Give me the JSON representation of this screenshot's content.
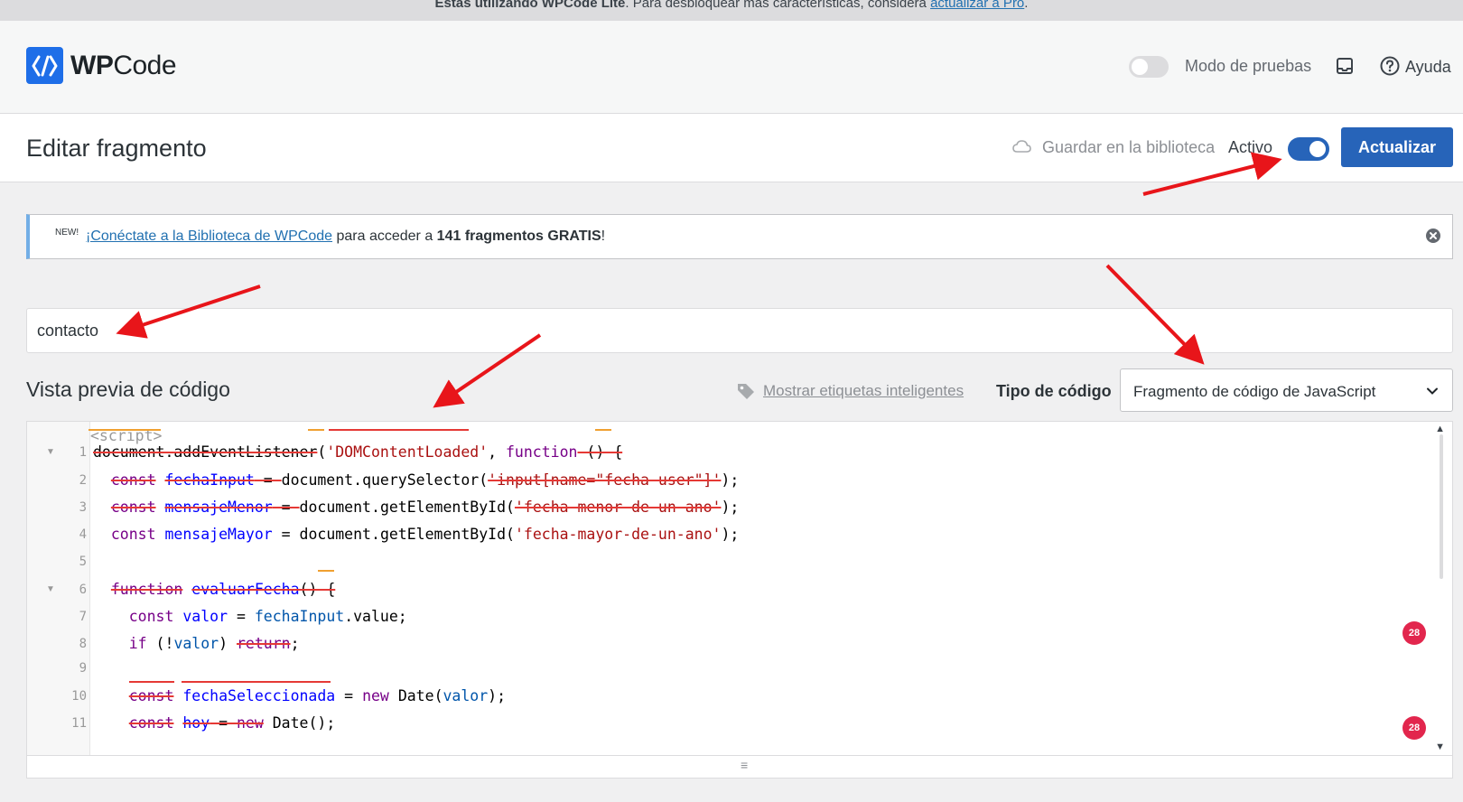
{
  "top_notice": {
    "prefix": "Estás utilizando WPCode Lite",
    "middle": ". Para desbloquear más características, considera ",
    "link": "actualizar a Pro",
    "suffix": "."
  },
  "header": {
    "logo_wp": "WP",
    "logo_code": "Code",
    "test_mode_label": "Modo de pruebas",
    "help_label": "Ayuda"
  },
  "titlebar": {
    "title": "Editar fragmento",
    "save_library": "Guardar en la biblioteca",
    "active_label": "Activo",
    "update_button": "Actualizar"
  },
  "notice": {
    "new_badge": "NEW!",
    "link": "¡Conéctate a la Biblioteca de WPCode",
    "text1": " para acceder a ",
    "bold": "141 fragmentos GRATIS",
    "text2": "!"
  },
  "snippet_title": "contacto",
  "preview": {
    "label": "Vista previa de código",
    "smart_tags": "Mostrar etiquetas inteligentes",
    "code_type_label": "Tipo de código",
    "code_type_value": "Fragmento de código de JavaScript"
  },
  "code": {
    "script_tag": "<script>",
    "line_numbers": [
      "1",
      "2",
      "3",
      "4",
      "5",
      "6",
      "7",
      "8",
      "9",
      "10",
      "11"
    ],
    "lines": [
      [
        {
          "t": "document",
          "c": "plain"
        },
        {
          "t": ".",
          "c": "plain"
        },
        {
          "t": "addEventListener",
          "c": "plain"
        },
        {
          "t": "(",
          "c": "plain"
        },
        {
          "t": "'DOMContentLoaded'",
          "c": "str"
        },
        {
          "t": ", ",
          "c": "plain"
        },
        {
          "t": "function",
          "c": "kw"
        },
        {
          "t": " () {",
          "c": "plain"
        }
      ],
      [
        {
          "t": "  ",
          "c": "plain"
        },
        {
          "t": "const",
          "c": "kw"
        },
        {
          "t": " ",
          "c": "plain"
        },
        {
          "t": "fechaInput",
          "c": "def"
        },
        {
          "t": " = ",
          "c": "plain"
        },
        {
          "t": "document",
          "c": "plain"
        },
        {
          "t": ".",
          "c": "plain"
        },
        {
          "t": "querySelector",
          "c": "plain"
        },
        {
          "t": "(",
          "c": "plain"
        },
        {
          "t": "'input[name=\"fecha-user\"]'",
          "c": "str"
        },
        {
          "t": ");",
          "c": "plain"
        }
      ],
      [
        {
          "t": "  ",
          "c": "plain"
        },
        {
          "t": "const",
          "c": "kw"
        },
        {
          "t": " ",
          "c": "plain"
        },
        {
          "t": "mensajeMenor",
          "c": "def"
        },
        {
          "t": " = ",
          "c": "plain"
        },
        {
          "t": "document",
          "c": "plain"
        },
        {
          "t": ".",
          "c": "plain"
        },
        {
          "t": "getElementById",
          "c": "plain"
        },
        {
          "t": "(",
          "c": "plain"
        },
        {
          "t": "'fecha-menor-de-un-ano'",
          "c": "str"
        },
        {
          "t": ");",
          "c": "plain"
        }
      ],
      [
        {
          "t": "  ",
          "c": "plain"
        },
        {
          "t": "const",
          "c": "kw"
        },
        {
          "t": " ",
          "c": "plain"
        },
        {
          "t": "mensajeMayor",
          "c": "def"
        },
        {
          "t": " = ",
          "c": "plain"
        },
        {
          "t": "document",
          "c": "plain"
        },
        {
          "t": ".",
          "c": "plain"
        },
        {
          "t": "getElementById",
          "c": "plain"
        },
        {
          "t": "(",
          "c": "plain"
        },
        {
          "t": "'fecha-mayor-de-un-ano'",
          "c": "str"
        },
        {
          "t": ");",
          "c": "plain"
        }
      ],
      [],
      [
        {
          "t": "  ",
          "c": "plain"
        },
        {
          "t": "function",
          "c": "kw"
        },
        {
          "t": " ",
          "c": "plain"
        },
        {
          "t": "evaluarFecha",
          "c": "def"
        },
        {
          "t": "() {",
          "c": "plain"
        }
      ],
      [
        {
          "t": "    ",
          "c": "plain"
        },
        {
          "t": "const",
          "c": "kw"
        },
        {
          "t": " ",
          "c": "plain"
        },
        {
          "t": "valor",
          "c": "def"
        },
        {
          "t": " = ",
          "c": "plain"
        },
        {
          "t": "fechaInput",
          "c": "var"
        },
        {
          "t": ".",
          "c": "plain"
        },
        {
          "t": "value",
          "c": "plain"
        },
        {
          "t": ";",
          "c": "plain"
        }
      ],
      [
        {
          "t": "    ",
          "c": "plain"
        },
        {
          "t": "if",
          "c": "kw"
        },
        {
          "t": " (!",
          "c": "plain"
        },
        {
          "t": "valor",
          "c": "var"
        },
        {
          "t": ") ",
          "c": "plain"
        },
        {
          "t": "return",
          "c": "kw"
        },
        {
          "t": ";",
          "c": "plain"
        }
      ],
      [],
      [
        {
          "t": "    ",
          "c": "plain"
        },
        {
          "t": "const",
          "c": "kw"
        },
        {
          "t": " ",
          "c": "plain"
        },
        {
          "t": "fechaSeleccionada",
          "c": "def"
        },
        {
          "t": " = ",
          "c": "plain"
        },
        {
          "t": "new",
          "c": "kw"
        },
        {
          "t": " ",
          "c": "plain"
        },
        {
          "t": "Date",
          "c": "plain"
        },
        {
          "t": "(",
          "c": "plain"
        },
        {
          "t": "valor",
          "c": "var"
        },
        {
          "t": ");",
          "c": "plain"
        }
      ],
      [
        {
          "t": "    ",
          "c": "plain"
        },
        {
          "t": "const",
          "c": "kw"
        },
        {
          "t": " ",
          "c": "plain"
        },
        {
          "t": "hoy",
          "c": "def"
        },
        {
          "t": " = ",
          "c": "plain"
        },
        {
          "t": "new",
          "c": "kw"
        },
        {
          "t": " ",
          "c": "plain"
        },
        {
          "t": "Date",
          "c": "plain"
        },
        {
          "t": "();",
          "c": "plain"
        }
      ]
    ]
  },
  "badges": [
    "28",
    "28"
  ],
  "colors": {
    "brand": "#1e6ee8",
    "primary_button": "#2764b9",
    "annotation_arrow": "#e8151a"
  }
}
